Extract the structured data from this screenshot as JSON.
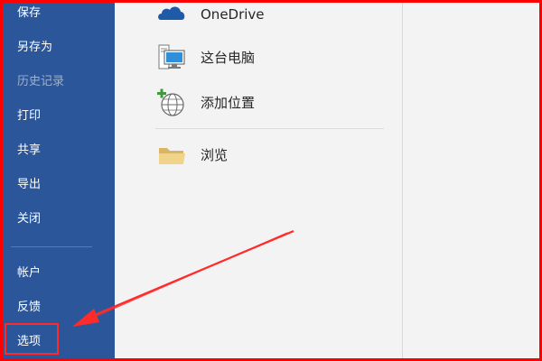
{
  "sidebar": {
    "items": [
      {
        "label": "保存",
        "enabled": true
      },
      {
        "label": "另存为",
        "enabled": true
      },
      {
        "label": "历史记录",
        "enabled": false
      },
      {
        "label": "打印",
        "enabled": true
      },
      {
        "label": "共享",
        "enabled": true
      },
      {
        "label": "导出",
        "enabled": true
      },
      {
        "label": "关闭",
        "enabled": true
      },
      {
        "label": "帐户",
        "enabled": true
      },
      {
        "label": "反馈",
        "enabled": true
      },
      {
        "label": "选项",
        "enabled": true
      }
    ]
  },
  "locations": {
    "items": [
      {
        "label": "OneDrive",
        "icon": "onedrive-cloud-icon"
      },
      {
        "label": "这台电脑",
        "icon": "computer-icon"
      },
      {
        "label": "添加位置",
        "icon": "add-place-globe-icon"
      },
      {
        "label": "浏览",
        "icon": "folder-icon"
      }
    ]
  },
  "annotation": {
    "highlight": "sidebar-item-options",
    "color": "#ff2b2b"
  },
  "colors": {
    "sidebar_bg": "#2b579a",
    "sidebar_text": "#ffffff",
    "sidebar_disabled_text": "#9eb0cf",
    "main_bg": "#f3f3f3",
    "frame_border": "#ff0000"
  }
}
